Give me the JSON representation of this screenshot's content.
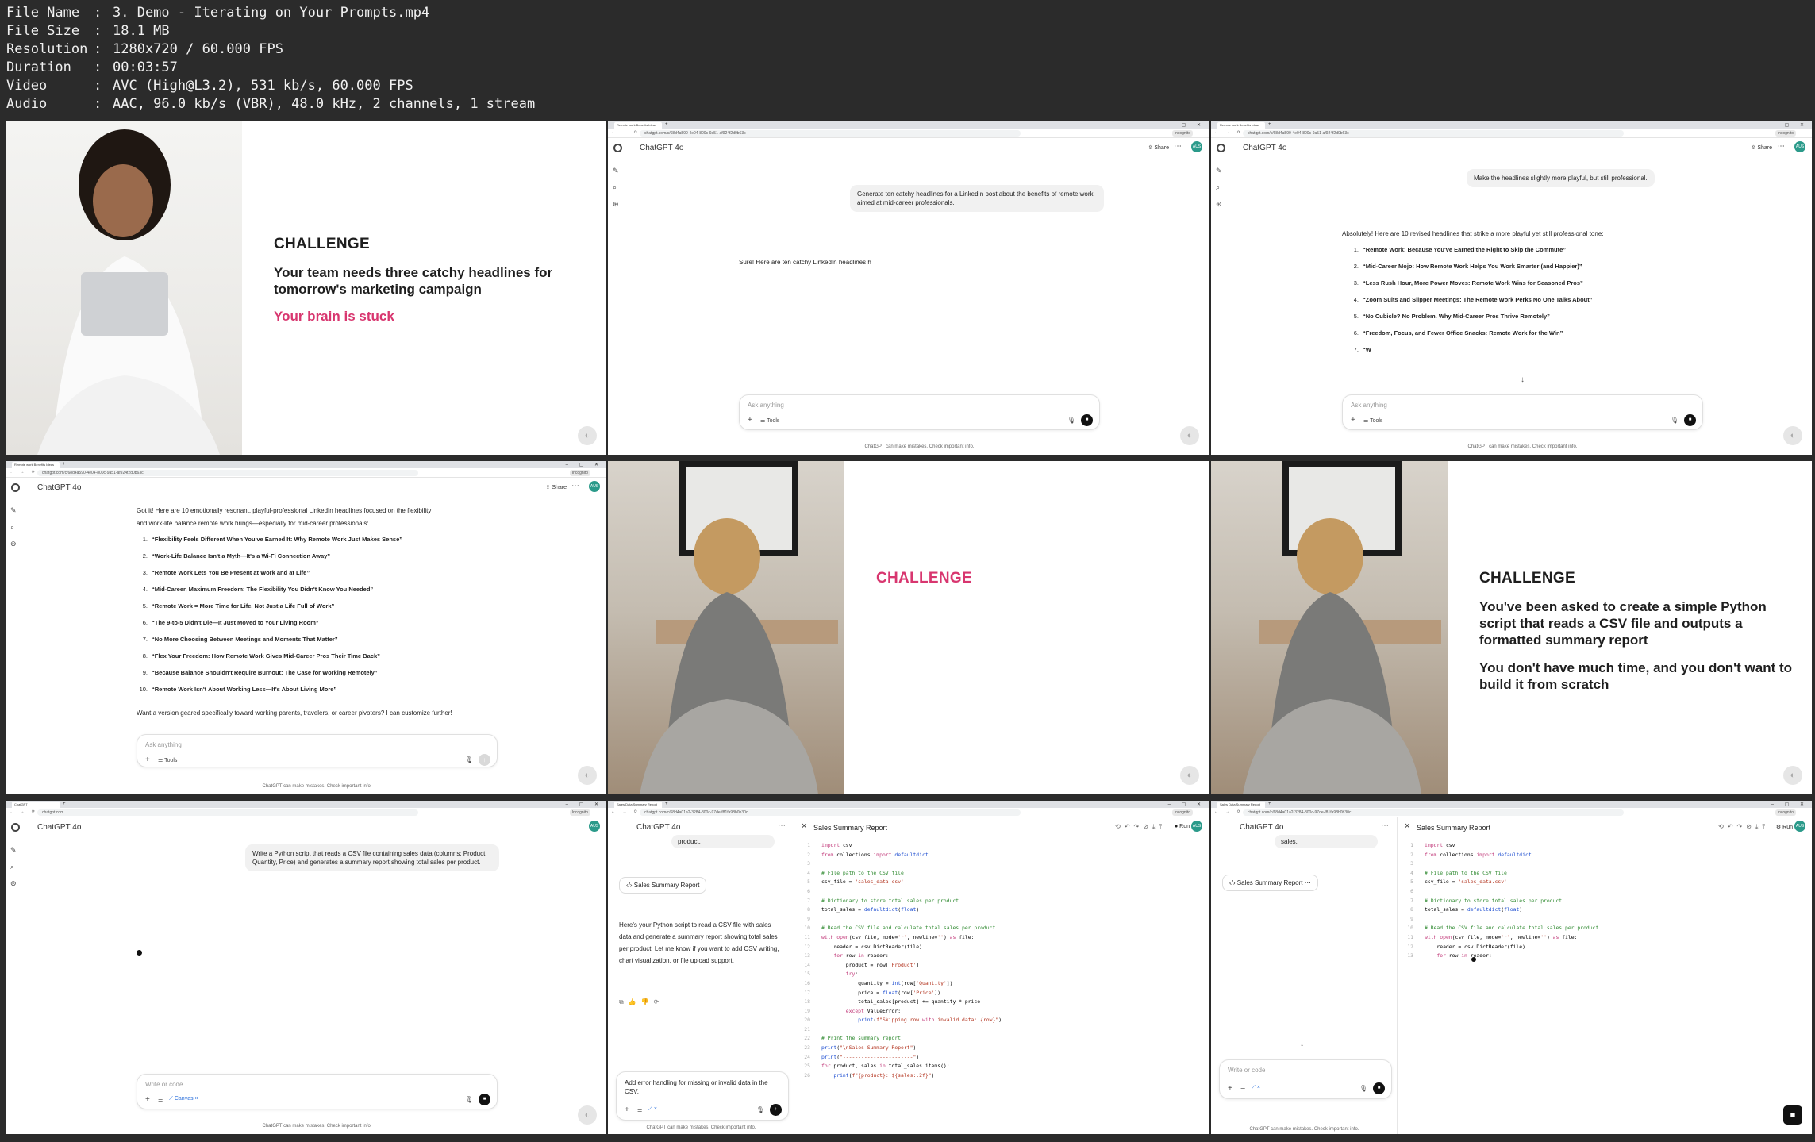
{
  "meta": [
    {
      "key": "File Name",
      "value": "3. Demo - Iterating on Your Prompts.mp4"
    },
    {
      "key": "File Size",
      "value": "18.1 MB"
    },
    {
      "key": "Resolution",
      "value": "1280x720 / 60.000 FPS"
    },
    {
      "key": "Duration",
      "value": "00:03:57"
    },
    {
      "key": "Video",
      "value": "AVC (High@L3.2), 531 kb/s, 60.000 FPS"
    },
    {
      "key": "Audio",
      "value": "AAC, 96.0 kb/s (VBR), 48.0 kHz, 2 channels, 1 stream"
    }
  ],
  "colon": ":",
  "common": {
    "model": "ChatGPT 4o",
    "share": "Share",
    "ask_anything": "Ask anything",
    "write_or_code": "Write or code",
    "tools": "Tools",
    "canvas": "Canvas",
    "disclaimer": "ChatGPT can make mistakes. Check important info.",
    "avatar": "AUS",
    "incognito": "Incognito",
    "url1": "chatgpt.com/c/68d4a590-4e04-800c-9a51-af924f2d0b63c",
    "url2": "chatgpt.com",
    "url3": "chatgpt.com/c/68d4a01a2-3284-800c-97de-f81fa98b0b30c",
    "tab1": "Remote work Benefits Ideas",
    "tab2": "ChatGPT",
    "tab3": "Sales Data Summary Report",
    "run": "Run",
    "sales_summary": "Sales Summary Report"
  },
  "slide1": {
    "heading": "CHALLENGE",
    "body": "Your team needs three catchy headlines for tomorrow's marketing campaign",
    "pink": "Your brain is stuck"
  },
  "tile1": {
    "user": "Generate ten catchy headlines for a LinkedIn post about the benefits of remote work, aimed at mid-career professionals.",
    "assistant": "Sure! Here are ten catchy LinkedIn headlines h"
  },
  "tile2": {
    "user": "Make the headlines slightly more playful, but still professional.",
    "intro": "Absolutely! Here are 10 revised headlines that strike a more playful yet still professional tone:",
    "items": [
      "“Remote Work: Because You've Earned the Right to Skip the Commute”",
      "“Mid-Career Mojo: How Remote Work Helps You Work Smarter (and Happier)”",
      "“Less Rush Hour, More Power Moves: Remote Work Wins for Seasoned Pros”",
      "“Zoom Suits and Slipper Meetings: The Remote Work Perks No One Talks About”",
      "“No Cubicle? No Problem. Why Mid-Career Pros Thrive Remotely”",
      "“Freedom, Focus, and Fewer Office Snacks: Remote Work for the Win”",
      "“W"
    ]
  },
  "tile3": {
    "intro1": "Got it! Here are 10 emotionally resonant, playful-professional LinkedIn headlines focused on the flexibility",
    "intro2": "and work-life balance remote work brings—especially for mid-career professionals:",
    "items": [
      "“Flexibility Feels Different When You've Earned It: Why Remote Work Just Makes Sense”",
      "“Work-Life Balance Isn't a Myth—It's a Wi-Fi Connection Away”",
      "“Remote Work Lets You Be Present at Work and at Life”",
      "“Mid-Career, Maximum Freedom: The Flexibility You Didn't Know You Needed”",
      "“Remote Work = More Time for Life, Not Just a Life Full of Work”",
      "“The 9-to-5 Didn't Die—It Just Moved to Your Living Room”",
      "“No More Choosing Between Meetings and Moments That Matter”",
      "“Flex Your Freedom: How Remote Work Gives Mid-Career Pros Their Time Back”",
      "“Because Balance Shouldn't Require Burnout: The Case for Working Remotely”",
      "“Remote Work Isn't About Working Less—It's About Living More”"
    ],
    "outro": "Want a version geared specifically toward working parents, travelers, or career pivoters? I can customize further!"
  },
  "slide4": {
    "heading": "CHALLENGE"
  },
  "slide5": {
    "heading": "CHALLENGE",
    "body": "You've been asked to create a simple Python script that reads a CSV file and outputs a formatted summary report",
    "body2": "You don't have much time, and you don't want to build it from scratch"
  },
  "tile6": {
    "user": "Write a Python script that reads a CSV file containing sales data (columns: Product, Quantity, Price) and generates a summary report showing total sales per product."
  },
  "tile7": {
    "prev": "product.",
    "assistant": "Here's your Python script to read a CSV file with sales data and generate a summary report showing total sales per product. Let me know if you want to add CSV writing, chart visualization, or file upload support.",
    "composer": "Add error handling for missing or invalid data in the CSV.",
    "code": [
      "import csv",
      "from collections import defaultdict",
      "",
      "# File path to the CSV file",
      "csv_file = 'sales_data.csv'",
      "",
      "# Dictionary to store total sales per product",
      "total_sales = defaultdict(float)",
      "",
      "# Read the CSV file and calculate total sales per product",
      "with open(csv_file, mode='r', newline='') as file:",
      "    reader = csv.DictReader(file)",
      "    for row in reader:",
      "        product = row['Product']",
      "        try:",
      "            quantity = int(row['Quantity'])",
      "            price = float(row['Price'])",
      "            total_sales[product] += quantity * price",
      "        except ValueError:",
      "            print(f\"Skipping row with invalid data: {row}\")",
      "",
      "# Print the summary report",
      "print(\"\\nSales Summary Report\")",
      "print(\"-----------------------\")",
      "for product, sales in total_sales.items():",
      "    print(f\"{product}: ${sales:.2f}\")"
    ]
  },
  "tile8": {
    "prev": "sales.",
    "code": [
      "import csv",
      "from collections import defaultdict",
      "",
      "# File path to the CSV file",
      "csv_file = 'sales_data.csv'",
      "",
      "# Dictionary to store total sales per product",
      "total_sales = defaultdict(float)",
      "",
      "# Read the CSV file and calculate total sales per product",
      "with open(csv_file, mode='r', newline='') as file:",
      "    reader = csv.DictReader(file)",
      "    for row in reader:"
    ]
  }
}
